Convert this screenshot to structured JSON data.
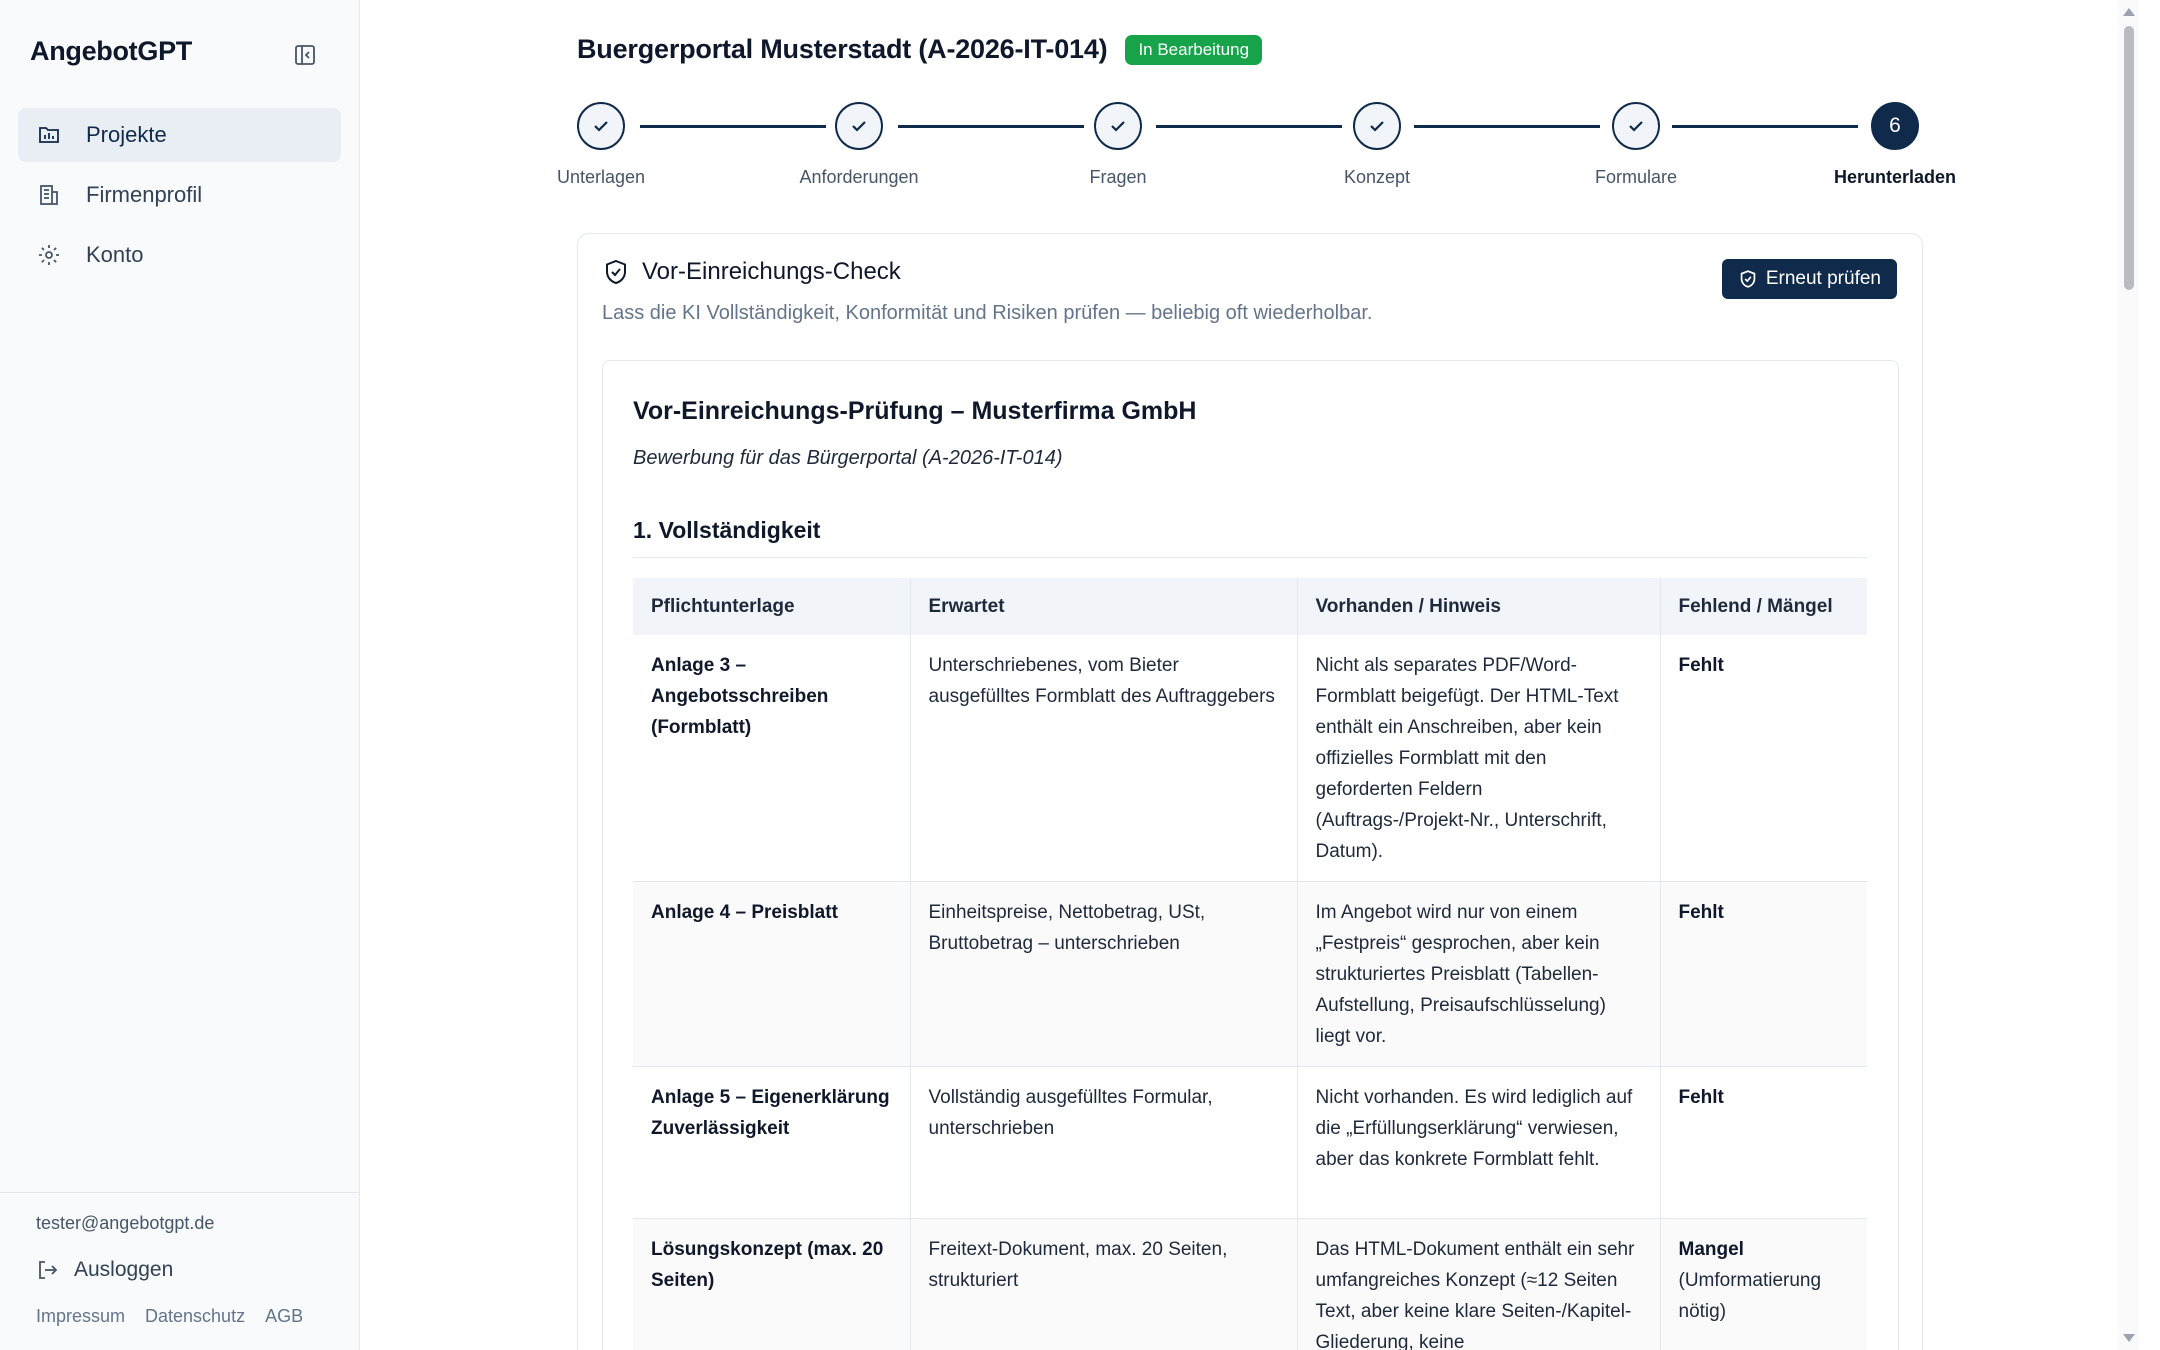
{
  "app": {
    "brand": "AngebotGPT"
  },
  "sidebar": {
    "items": [
      {
        "label": "Projekte",
        "icon": "folder-chart-icon",
        "active": true
      },
      {
        "label": "Firmenprofil",
        "icon": "building-icon",
        "active": false
      },
      {
        "label": "Konto",
        "icon": "gear-icon",
        "active": false
      }
    ],
    "user_email": "tester@angebotgpt.de",
    "logout_label": "Ausloggen",
    "legal": [
      "Impressum",
      "Datenschutz",
      "AGB"
    ]
  },
  "header": {
    "title": "Buergerportal Musterstadt (A-2026-IT-014)",
    "status": "In Bearbeitung",
    "status_color": "#16a34a"
  },
  "stepper": {
    "steps": [
      {
        "label": "Unterlagen",
        "done": true
      },
      {
        "label": "Anforderungen",
        "done": true
      },
      {
        "label": "Fragen",
        "done": true
      },
      {
        "label": "Konzept",
        "done": true
      },
      {
        "label": "Formulare",
        "done": true
      },
      {
        "label": "Herunterladen",
        "done": false,
        "number": "6"
      }
    ],
    "current_step": 6
  },
  "check": {
    "title": "Vor-Einreichungs-Check",
    "subtitle": "Lass die KI Vollständigkeit, Konformität und Risiken prüfen — beliebig oft wiederholbar.",
    "button_label": "Erneut prüfen"
  },
  "report": {
    "title": "Vor-Einreichungs-Prüfung – Musterfirma GmbH",
    "subtitle": "Bewerbung für das Bürgerportal (A-2026-IT-014)",
    "section_title": "1. Vollständigkeit",
    "table": {
      "headers": [
        "Pflichtunterlage",
        "Erwartet",
        "Vorhanden / Hinweis",
        "Fehlend / Mängel"
      ],
      "rows": [
        {
          "document": "Anlage 3 – Angebotsschreiben (Formblatt)",
          "expected": "Unterschriebenes, vom Bieter ausgefülltes Formblatt des Auftraggebers",
          "note": "Nicht als separates PDF/Word-Formblatt beigefügt. Der HTML-Text enthält ein Anschreiben, aber kein offizielles Formblatt mit den geforderten Feldern (Auftrags-/Projekt-Nr., Unterschrift, Datum).",
          "status": "Fehlt",
          "status_detail": ""
        },
        {
          "document": "Anlage 4 – Preisblatt",
          "expected": "Einheitspreise, Nettobetrag, USt, Bruttobetrag – unterschrieben",
          "note": "Im Angebot wird nur von einem „Festpreis“ gesprochen, aber kein strukturiertes Preisblatt (Tabellen-Aufstellung, Preisaufschlüsselung) liegt vor.",
          "status": "Fehlt",
          "status_detail": ""
        },
        {
          "document": "Anlage 5 – Eigenerklärung Zuverlässigkeit",
          "expected": "Vollständig ausgefülltes Formular, unterschrieben",
          "note": "Nicht vorhanden. Es wird lediglich auf die „Erfüllungserklärung“ verwiesen, aber das konkrete Formblatt fehlt.",
          "status": "Fehlt",
          "status_detail": ""
        },
        {
          "document": "Lösungskonzept (max. 20 Seiten)",
          "expected": "Freitext-Dokument, max. 20 Seiten, strukturiert",
          "note": "Das HTML-Dokument enthält ein sehr umfangreiches Konzept (≈12 Seiten Text, aber keine klare Seiten-/Kapitel-Gliederung, keine",
          "status": "Mangel",
          "status_detail": "(Umformatierung nötig)"
        }
      ]
    }
  }
}
